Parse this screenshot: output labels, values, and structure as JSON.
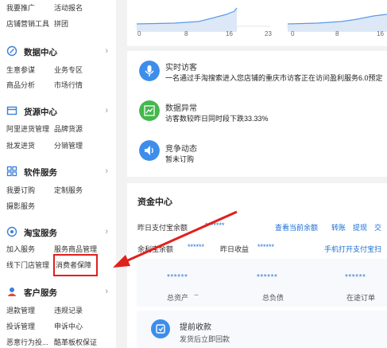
{
  "sidebar": {
    "top_row1": [
      "我要推广",
      "活动报名"
    ],
    "top_row2": [
      "店铺营销工具",
      "拼团"
    ],
    "sections": [
      {
        "title": "数据中心",
        "icon": "data-center-icon",
        "rows": [
          [
            "生意参谋",
            "业务专区"
          ],
          [
            "商品分析",
            "市场行情"
          ]
        ]
      },
      {
        "title": "货源中心",
        "icon": "supply-center-icon",
        "rows": [
          [
            "阿里进货管理",
            "品牌货源"
          ],
          [
            "批发进货",
            "分销管理"
          ]
        ]
      },
      {
        "title": "软件服务",
        "icon": "software-service-icon",
        "rows": [
          [
            "我要订购",
            "定制服务"
          ],
          [
            "摄影服务"
          ]
        ]
      },
      {
        "title": "淘宝服务",
        "icon": "taobao-service-icon",
        "rows": [
          [
            "加入服务",
            "服务商品管理"
          ],
          [
            "线下门店管理",
            "消费者保障"
          ]
        ]
      },
      {
        "title": "客户服务",
        "icon": "customer-service-icon",
        "rows": [
          [
            "退款管理",
            "违规记录"
          ],
          [
            "投诉管理",
            "申诉中心"
          ],
          [
            "恶意行为投...",
            "酷革板权保证"
          ]
        ]
      }
    ]
  },
  "chart1": {
    "ticks": [
      "0",
      "8",
      "16",
      "23"
    ]
  },
  "chart2": {
    "ticks": [
      "0",
      "8",
      "16"
    ]
  },
  "notices": [
    {
      "title": "实时访客",
      "desc": "一名通过手淘搜索进入您店铺的重庆市访客正在访问盈利服务6.0预定",
      "icon": "microphone-icon",
      "color": "#3d8eea"
    },
    {
      "title": "数据异常",
      "desc": "访客数较昨日同时段下跌33.33%",
      "icon": "trend-chart-icon",
      "color": "#43b84d"
    },
    {
      "title": "竞争动态",
      "desc": "暂未订购",
      "icon": "speaker-icon",
      "color": "#3d8eea"
    }
  ],
  "funds": {
    "title": "资金中心",
    "yesterday_label": "昨日支付宝余额",
    "yesterday_value": "*******",
    "links": [
      "查看当前余额",
      "转账",
      "提现",
      "交"
    ],
    "balance_label": "余利宝余额",
    "balance_value": "******",
    "income_label": "昨日收益",
    "income_value": "******",
    "mobile_link": "手机打开支付宝扫",
    "stats": [
      {
        "value": "******",
        "label": "总资产"
      },
      {
        "value": "******",
        "label": "总负债"
      },
      {
        "value": "******",
        "label": "在途订单"
      }
    ],
    "withdraw_title": "提前收款",
    "withdraw_desc": "发货后立即回款"
  }
}
